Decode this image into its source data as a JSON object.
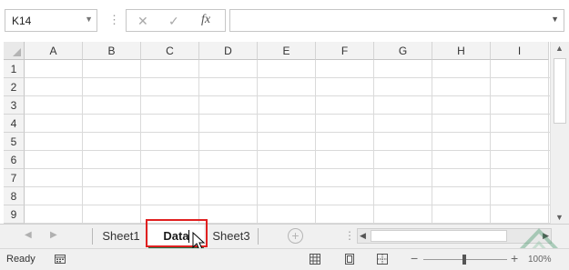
{
  "formula_bar": {
    "name_box": "K14",
    "cancel_icon": "✕",
    "enter_icon": "✓",
    "fx_label": "fx",
    "formula_value": ""
  },
  "columns": [
    "A",
    "B",
    "C",
    "D",
    "E",
    "F",
    "G",
    "H",
    "I"
  ],
  "rows": [
    "1",
    "2",
    "3",
    "4",
    "5",
    "6",
    "7",
    "8",
    "9"
  ],
  "sheet_tabs": [
    {
      "label": "Sheet1",
      "active": false
    },
    {
      "label": "Data",
      "active": true
    },
    {
      "label": "Sheet3",
      "active": false
    }
  ],
  "add_sheet": "+",
  "status": {
    "mode": "Ready",
    "zoom_minus": "−",
    "zoom_plus": "+",
    "zoom_value": "100%"
  },
  "colors": {
    "highlight": "#e02020",
    "active_tab_underline": "#217346"
  }
}
